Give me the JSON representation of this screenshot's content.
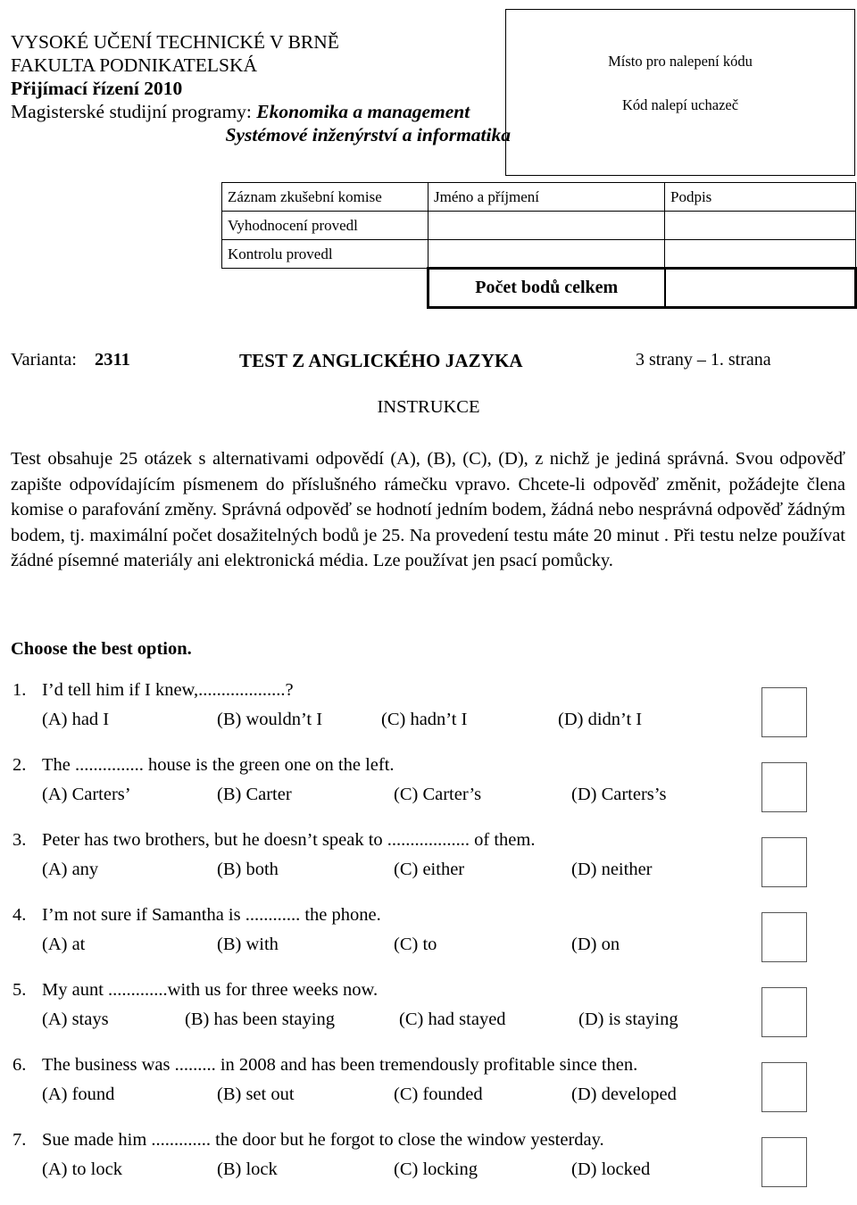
{
  "header": {
    "university": "VYSOKÉ UČENÍ TECHNICKÉ V BRNĚ",
    "faculty": "FAKULTA PODNIKATELSKÁ",
    "admission": "Přijímací řízení 2010",
    "programs_prefix": "Magisterské studijní programy: ",
    "program_1": "Ekonomika a management",
    "program_2": "Systémové inženýrství a informatika"
  },
  "code_box": {
    "line_1": "Místo pro nalepení kódu",
    "line_2": "Kód nalepí uchazeč"
  },
  "committee_table": {
    "columns": [
      "Záznam zkušební komise",
      "Jméno a příjmení",
      "Podpis"
    ],
    "rows": [
      {
        "label": "Vyhodnocení provedl",
        "name": "",
        "signature": ""
      },
      {
        "label": "Kontrolu provedl",
        "name": "",
        "signature": ""
      }
    ],
    "total_label": "Počet bodů celkem",
    "total_value": ""
  },
  "title_row": {
    "variant_label": "Varianta:",
    "variant_value": "2311",
    "test_title": "TEST Z ANGLICKÉHO JAZYKA",
    "page_info": "3 strany – 1. strana"
  },
  "instructions": {
    "heading": "INSTRUKCE",
    "body": "Test obsahuje 25 otázek s alternativami odpovědí (A), (B), (C), (D), z nichž je jediná správná. Svou odpověď  zapište odpovídajícím písmenem do příslušného rámečku vpravo. Chcete-li odpověď změnit, požádejte člena komise o parafování změny. Správná odpověď se hodnotí jedním bodem,  žádná nebo nesprávná odpověď žádným bodem, tj. maximální počet dosažitelných bodů je 25. Na provedení testu máte 20 minut . Při testu nelze používat žádné písemné materiály ani elektronická média. Lze používat jen psací pomůcky."
  },
  "questions_section": {
    "heading": "Choose the best option.",
    "items": [
      {
        "number": "1.",
        "text": "I’d tell him if I knew,...................?",
        "options": [
          "(A) had I",
          "(B) wouldn’t I",
          "(C) hadn’t I",
          "(D) didn’t I"
        ],
        "option_x": [
          47,
          243,
          427,
          625
        ]
      },
      {
        "number": "2.",
        "text": "The ............... house is the green one on the left.",
        "options": [
          "(A) Carters’",
          "(B) Carter",
          "(C) Carter’s",
          "(D) Carters’s"
        ],
        "option_x": [
          47,
          243,
          441,
          640
        ]
      },
      {
        "number": "3.",
        "text": "Peter has two brothers, but he doesn’t speak to .................. of them.",
        "options": [
          "(A) any",
          "(B) both",
          "(C) either",
          "(D) neither"
        ],
        "option_x": [
          47,
          243,
          441,
          640
        ]
      },
      {
        "number": "4.",
        "text": "I’m not sure if Samantha is ............ the phone.",
        "options": [
          "(A) at",
          "(B) with",
          "(C) to",
          "(D) on"
        ],
        "option_x": [
          47,
          243,
          441,
          640
        ]
      },
      {
        "number": "5.",
        "text": "My aunt .............with us for three weeks now.",
        "options": [
          "(A) stays",
          "(B) has been staying",
          "(C) had stayed",
          "(D) is staying"
        ],
        "option_x": [
          47,
          207,
          447,
          648
        ]
      },
      {
        "number": "6.",
        "text": "The business was ......... in 2008 and has been tremendously profitable since then.",
        "options": [
          "(A) found",
          "(B) set out",
          "(C) founded",
          "(D) developed"
        ],
        "option_x": [
          47,
          243,
          441,
          640
        ]
      },
      {
        "number": "7.",
        "text": "Sue made him ............. the door but he forgot to close the window yesterday.",
        "options": [
          "(A) to lock",
          "(B) lock",
          "(C) locking",
          "(D) locked"
        ],
        "option_x": [
          47,
          243,
          441,
          640
        ]
      }
    ]
  }
}
